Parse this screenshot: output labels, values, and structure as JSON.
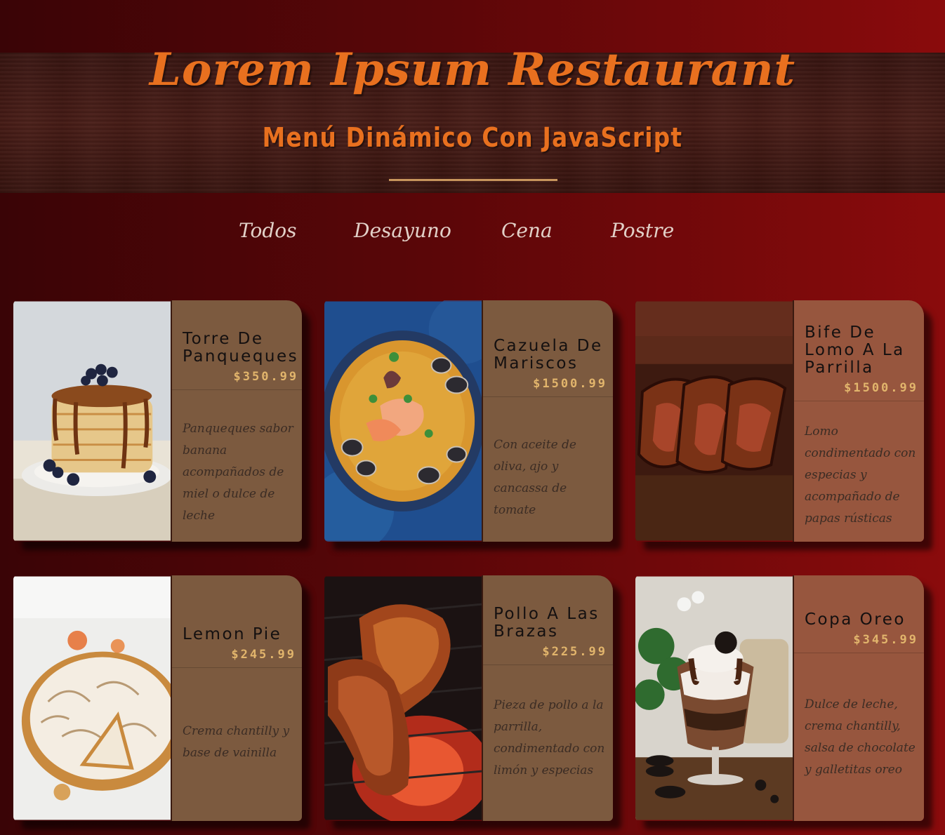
{
  "header": {
    "title": "Lorem Ipsum Restaurant",
    "subtitle": "Menú Dinámico Con JavaScript"
  },
  "filters": [
    {
      "label": "Todos"
    },
    {
      "label": "Desayuno"
    },
    {
      "label": "Cena"
    },
    {
      "label": "Postre"
    }
  ],
  "menu": [
    {
      "name": "Torre De Panqueques",
      "price": "$350.99",
      "description": "Panqueques sabor banana acompañados de miel o dulce de leche",
      "image": "pancakes-photo"
    },
    {
      "name": "Cazuela De Mariscos",
      "price": "$1500.99",
      "description": "Con aceite de oliva, ajo y cancassa de tomate",
      "image": "seafood-stew-photo"
    },
    {
      "name": "Bife De Lomo A La Parrilla",
      "price": "$1500.99",
      "description": "Lomo condimentado con especias y acompañado de papas rústicas",
      "image": "grilled-steak-photo"
    },
    {
      "name": "Lemon Pie",
      "price": "$245.99",
      "description": "Crema chantilly y base de vainilla",
      "image": "lemon-pie-photo"
    },
    {
      "name": "Pollo A Las Brazas",
      "price": "$225.99",
      "description": "Pieza de pollo a la parrilla, condimentado con limón y especias",
      "image": "grilled-chicken-photo"
    },
    {
      "name": "Copa Oreo",
      "price": "$345.99",
      "description": "Dulce de leche, crema chantilly, salsa de chocolate y galletitas oreo",
      "image": "oreo-cup-photo"
    }
  ]
}
